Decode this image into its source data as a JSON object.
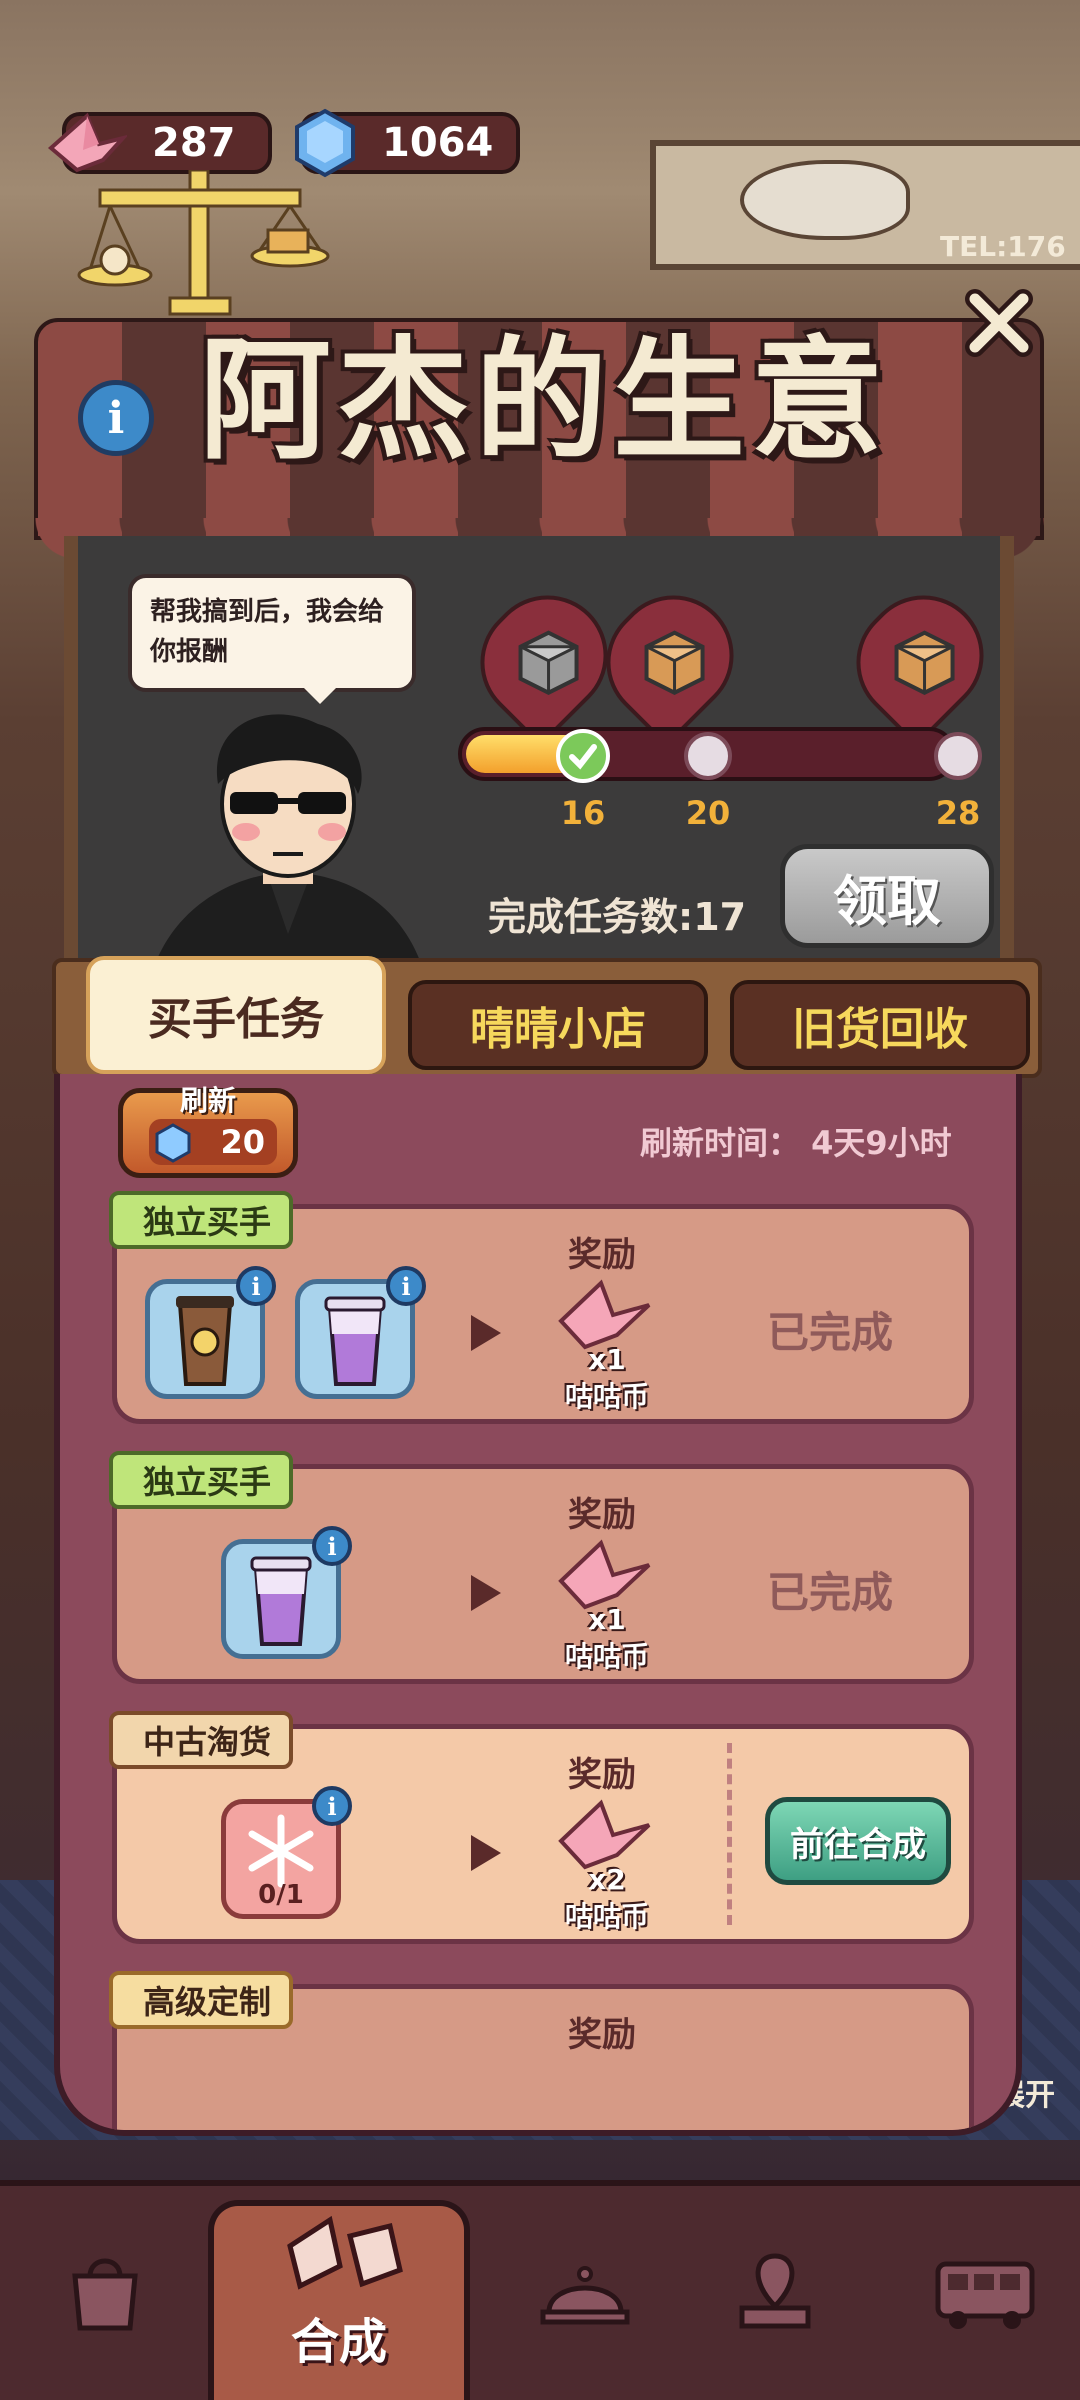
{
  "currency": {
    "crane_amount": "287",
    "gem_amount": "1064"
  },
  "background": {
    "tel_text": "TEL:176",
    "expand_label": "展开"
  },
  "panel": {
    "title": "阿杰的生意",
    "speech": "帮我搞到后，我会给你报酬",
    "milestones": [
      "16",
      "20",
      "28"
    ],
    "progress_fraction": 0.27,
    "done_count_label": "完成任务数:17",
    "claim_label": "领取"
  },
  "tabs": [
    {
      "label": "买手任务",
      "active": true
    },
    {
      "label": "晴晴小店",
      "active": false
    },
    {
      "label": "旧货回收",
      "active": false
    }
  ],
  "refresh": {
    "label": "刷新",
    "cost": "20",
    "time_text": "刷新时间： 4天9小时"
  },
  "tasks": [
    {
      "tag": "独立买手",
      "reward_label": "奖励",
      "reward_qty": "x1",
      "reward_name": "咕咕币",
      "status": "已完成"
    },
    {
      "tag": "独立买手",
      "reward_label": "奖励",
      "reward_qty": "x1",
      "reward_name": "咕咕币",
      "status": "已完成"
    },
    {
      "tag": "中古淘货",
      "item_qty": "0/1",
      "reward_label": "奖励",
      "reward_qty": "x2",
      "reward_name": "咕咕币",
      "action": "前往合成"
    },
    {
      "tag": "高级定制",
      "reward_label": "奖励"
    }
  ],
  "bottom_nav": {
    "active_label": "合成"
  },
  "colors": {
    "accent_gold": "#f2b13a",
    "tab_text": "#f6d85c",
    "card_bg": "#d69a86",
    "go_button": "#3e9f83"
  }
}
